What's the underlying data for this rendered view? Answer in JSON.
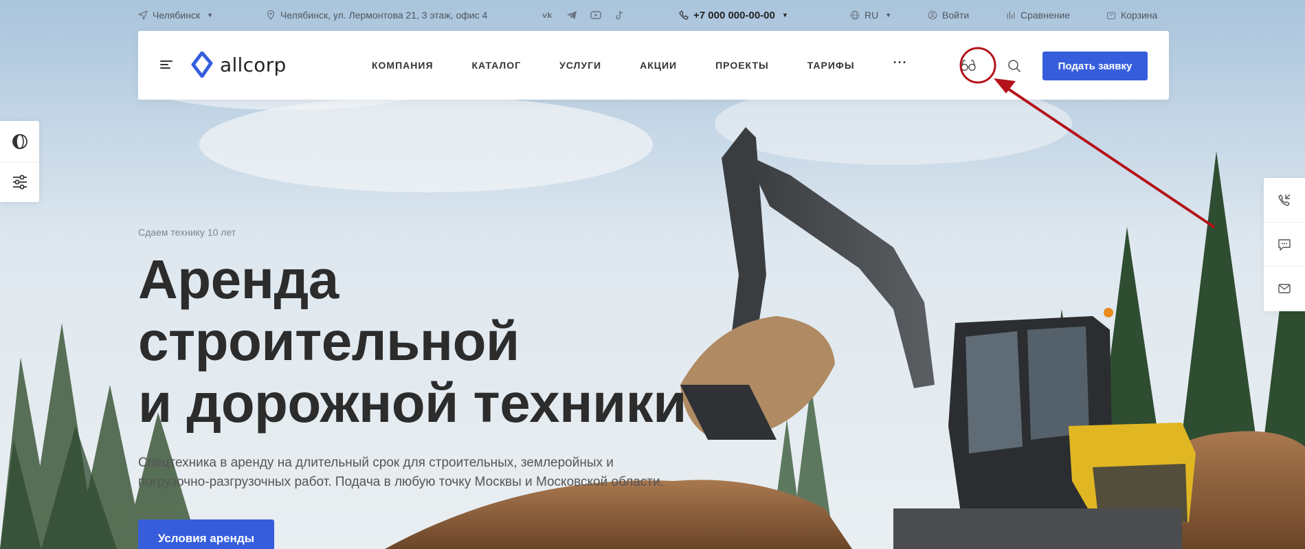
{
  "topbar": {
    "city": "Челябинск",
    "address": "Челябинск, ул. Лермонтова 21, 3 этаж, офис 4",
    "social_icons": [
      "vk-icon",
      "telegram-icon",
      "youtube-icon",
      "tiktok-icon"
    ],
    "phone": "+7 000 000-00-00",
    "lang": "RU",
    "login": "Войти",
    "compare": "Сравнение",
    "cart": "Корзина"
  },
  "header": {
    "logo_text": "allcorp",
    "nav": [
      "КОМПАНИЯ",
      "КАТАЛОГ",
      "УСЛУГИ",
      "АКЦИИ",
      "ПРОЕКТЫ",
      "ТАРИФЫ"
    ],
    "more": "···",
    "cta": "Подать заявку"
  },
  "hero": {
    "kicker": "Сдаем технику 10 лет",
    "title_line1": "Аренда строительной",
    "title_line2": "и дорожной техники",
    "description": "Спецтехника в аренду на длительный срок для строительных, землеройных и погрузочно-разгрузочных работ. Подача в любую точку Москвы и Московской области.",
    "button": "Условия аренды"
  },
  "side_left": {
    "icons": [
      "theme-toggle-icon",
      "settings-sliders-icon"
    ]
  },
  "side_right": {
    "icons": [
      "callback-phone-icon",
      "chat-icon",
      "mail-icon"
    ]
  },
  "colors": {
    "accent": "#365edc",
    "annotation": "#b5121b",
    "title": "#2c2c2c"
  }
}
